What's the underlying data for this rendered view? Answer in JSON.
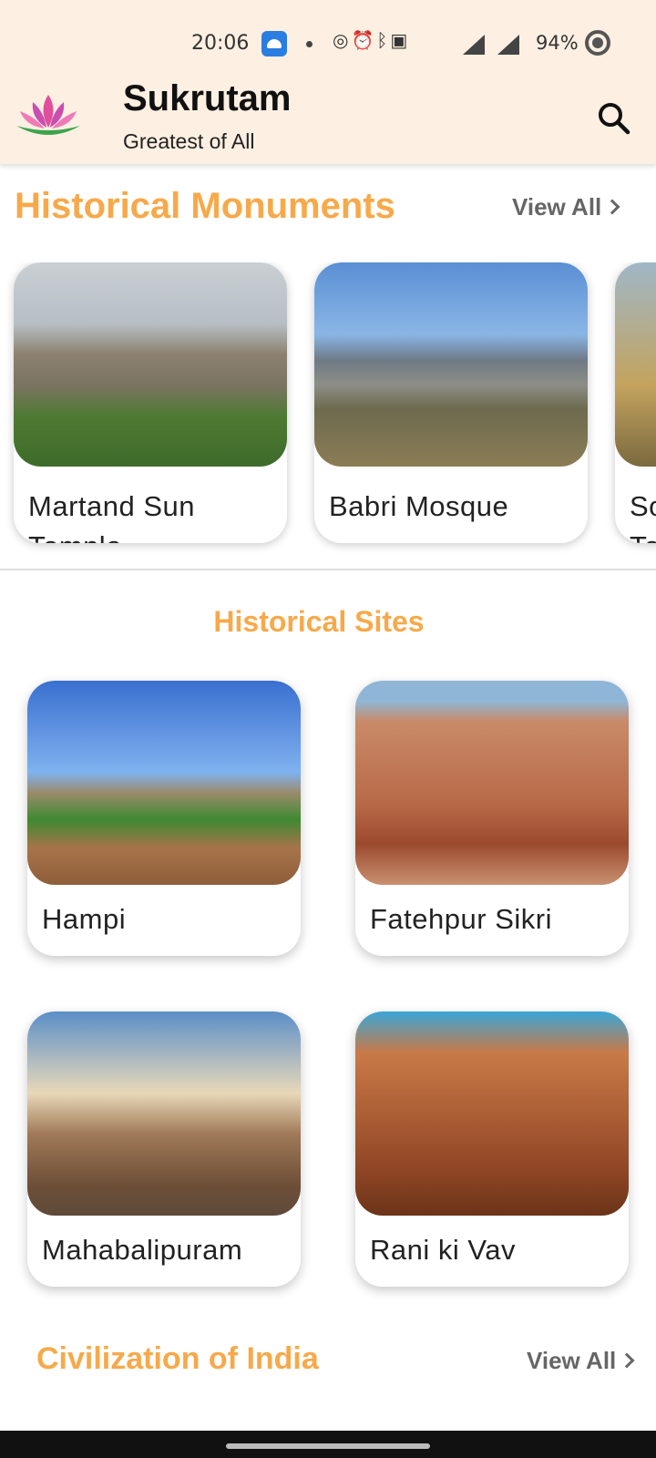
{
  "status_bar": {
    "time": "20:06",
    "battery": "94%",
    "icons": [
      "app-notification-icon",
      "dot-icon",
      "hotspot-icon",
      "alarm-icon",
      "bluetooth-icon",
      "volte-icon",
      "5g-signal-icon",
      "signal-icon",
      "battery-icon"
    ]
  },
  "app_bar": {
    "title": "Sukrutam",
    "subtitle": "Greatest of All",
    "logo": "lotus-logo",
    "search_icon": "search-icon"
  },
  "monuments": {
    "title": "Historical Monuments",
    "view_all": "View All",
    "items": [
      {
        "label": "Martand Sun Temple",
        "image": "martand-sun-temple-photo"
      },
      {
        "label": "Babri Mosque",
        "image": "babri-mosque-photo"
      },
      {
        "label": "So Te",
        "image": "third-monument-photo"
      }
    ]
  },
  "sites": {
    "title": "Historical Sites",
    "items": [
      {
        "label": "Hampi",
        "image": "hampi-photo"
      },
      {
        "label": "Fatehpur Sikri",
        "image": "fatehpur-sikri-photo"
      },
      {
        "label": "Mahabalipuram",
        "image": "mahabalipuram-photo"
      },
      {
        "label": "Rani ki Vav",
        "image": "rani-ki-vav-photo"
      }
    ]
  },
  "civilization": {
    "title": "Civilization of India",
    "view_all": "View All"
  },
  "colors": {
    "accent": "#f7a94a",
    "header_bg": "#fdf0e2",
    "view_all": "#666666"
  }
}
